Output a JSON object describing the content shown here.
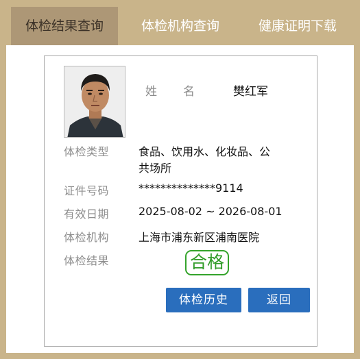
{
  "tabs": [
    {
      "label": "体检结果查询",
      "active": true
    },
    {
      "label": "体检机构查询",
      "active": false
    },
    {
      "label": "健康证明下载",
      "active": false
    }
  ],
  "record": {
    "name_label_1": "姓",
    "name_label_2": "名",
    "name": "樊红军",
    "exam_type_label": "体检类型",
    "exam_type_line1": "食品、饮用水、化妆品、公",
    "exam_type_line2": "共场所",
    "id_label": "证件号码",
    "id_number": "**************9114",
    "validity_label": "有效日期",
    "validity": "2025-08-02 ~ 2026-08-01",
    "institution_label": "体检机构",
    "institution": "上海市浦东新区浦南医院",
    "result_label": "体检结果",
    "result": "合格"
  },
  "buttons": {
    "history": "体检历史",
    "back": "返回"
  },
  "colors": {
    "frame": "#c9b48a",
    "active_tab": "#ad9776",
    "button": "#2a6ebd",
    "pass_green": "#34a32b"
  }
}
